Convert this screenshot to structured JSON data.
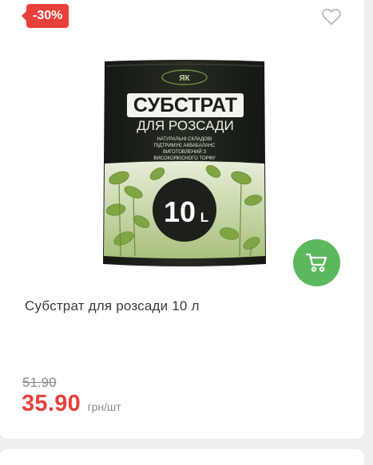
{
  "product": {
    "discount_badge": "-30%",
    "title": "Субстрат для розсади 10 л",
    "old_price": "51.90",
    "price": "35.90",
    "unit": "грн/шт",
    "image": {
      "headline": "СУБСТРАТ",
      "subhead": "ДЛЯ РОЗСАДИ",
      "features": [
        "НАТУРАЛЬНІ СКЛАДОВІ",
        "ПІДТРИМУЄ АКВАБАЛАНС",
        "ВИГОТОВЛЕНИЙ З",
        "ВИСОКОЯКІСНОГО ТОРФУ"
      ],
      "volume": "10",
      "volume_unit": "L"
    }
  },
  "icons": {
    "favorite": "heart-icon",
    "cart": "cart-icon"
  },
  "colors": {
    "accent_red": "#e8403a",
    "cart_green": "#5cb85c",
    "package_dark": "#1c1f1a"
  }
}
